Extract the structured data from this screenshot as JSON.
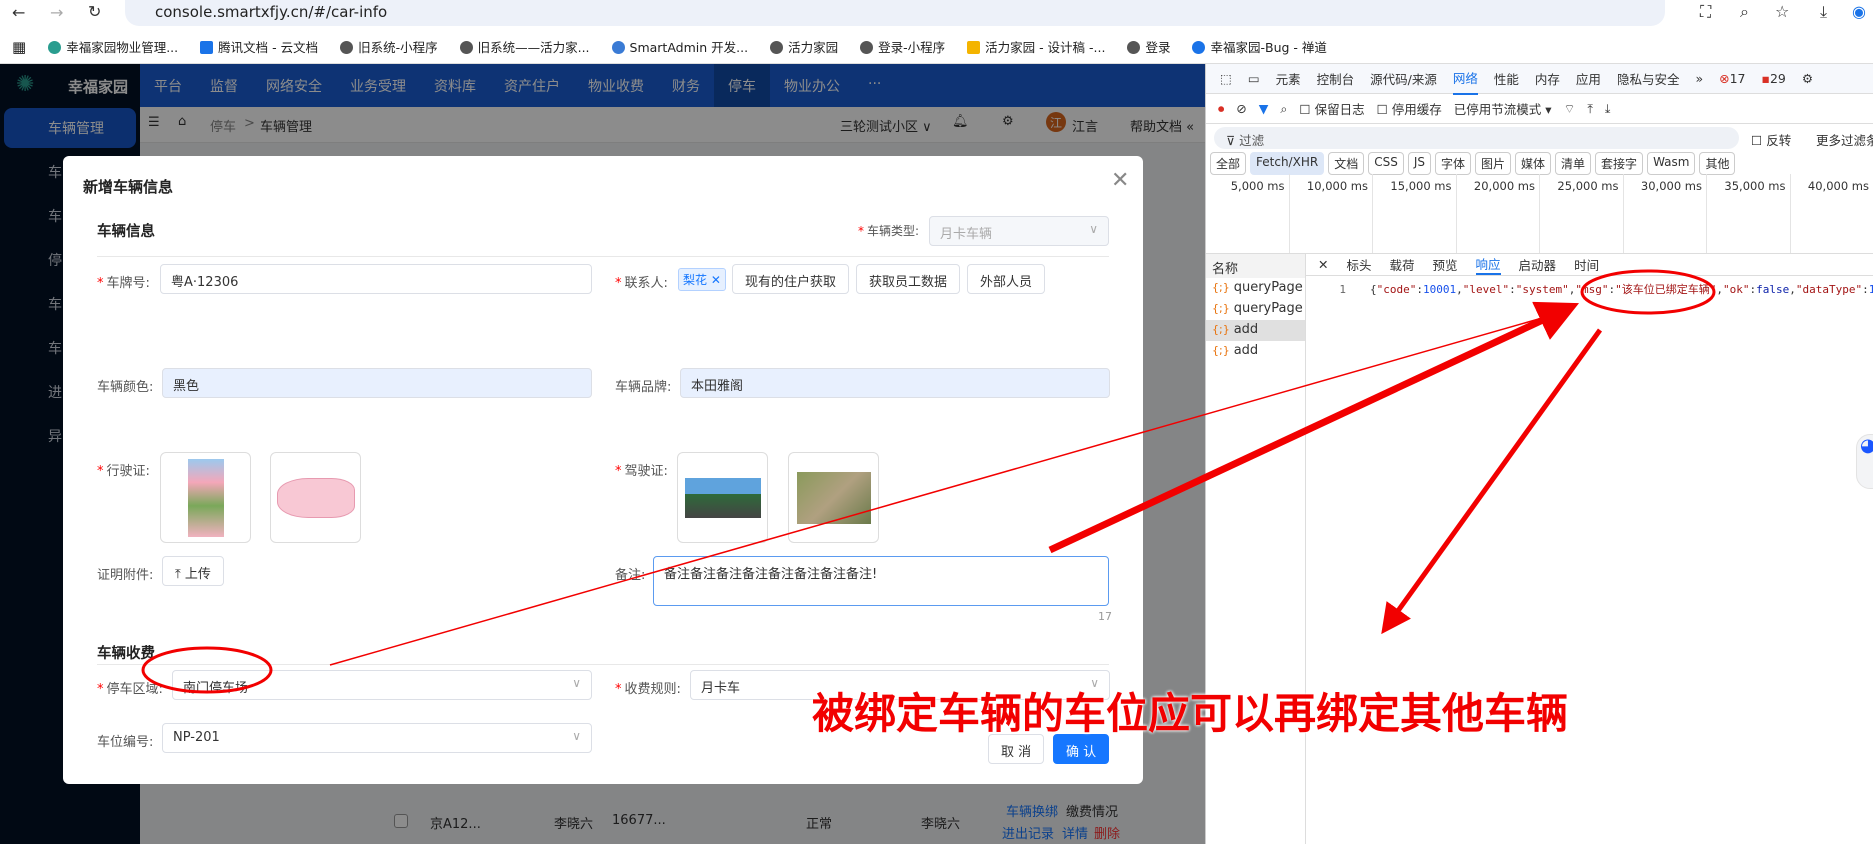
{
  "browser": {
    "url": "console.smartxfjy.cn/#/car-info",
    "bookmarks": [
      "幸福家园物业管理...",
      "腾讯文档 - 云文档",
      "旧系统-小程序",
      "旧系统——活力家...",
      "SmartAdmin 开发...",
      "活力家园",
      "登录-小程序",
      "活力家园 - 设计稿 -...",
      "登录",
      "幸福家园-Bug - 禅道"
    ]
  },
  "app": {
    "logo": "幸福家园",
    "top_nav": [
      "平台",
      "监督",
      "网络安全",
      "业务受理",
      "资料库",
      "资产住户",
      "物业收费",
      "财务",
      "停车",
      "物业办公",
      "···"
    ],
    "sidebar": [
      "车辆管理",
      "车",
      "车",
      "停",
      "车",
      "车",
      "进",
      "异"
    ],
    "breadcrumb": {
      "parent": "停车",
      "sep": ">",
      "current": "车辆管理"
    },
    "community": "三轮测试小区 ∨",
    "user_initial": "江",
    "user": "江言",
    "help": "帮助文档 «",
    "bg_row": {
      "plate": "京A12...",
      "owner": "李晓六",
      "phone": "16677...",
      "status": "正常",
      "contact": "李晓六",
      "links": [
        "车辆换绑",
        "缴费情况",
        "进出记录",
        "详情",
        "删除"
      ]
    }
  },
  "dialog": {
    "title": "新增车辆信息",
    "section1": "车辆信息",
    "vehicle_type_label": "车辆类型:",
    "vehicle_type": "月卡车辆",
    "plate_label": "车牌号:",
    "plate": "粤A·12306",
    "contact_label": "联系人:",
    "contact_tag": "梨花",
    "contact_buttons": [
      "现有的住户获取",
      "获取员工数据",
      "外部人员"
    ],
    "color_label": "车辆颜色:",
    "color": "黑色",
    "brand_label": "车辆品牌:",
    "brand": "本田雅阁",
    "license_label": "行驶证:",
    "driver_label": "驾驶证:",
    "attach_label": "证明附件:",
    "upload": "上传",
    "remark_label": "备注:",
    "remark": "备注备注备注备注备注备注备注备注!",
    "remark_count": "17",
    "section2": "车辆收费",
    "area_label": "停车区域:",
    "area": "南门停车场",
    "rule_label": "收费规则:",
    "rule": "月卡车",
    "spot_label": "车位编号:",
    "spot": "NP-201",
    "cancel": "取 消",
    "confirm": "确 认"
  },
  "devtools": {
    "tabs": [
      "元素",
      "控制台",
      "源代码/来源",
      "网络",
      "性能",
      "内存",
      "应用",
      "隐私与安全",
      "»"
    ],
    "errors": "17",
    "warnings": "29",
    "toolbar": {
      "preserve_log": "保留日志",
      "disable_cache": "停用缓存",
      "throttle": "已停用节流模式"
    },
    "filter_placeholder": "过滤",
    "invert": "反转",
    "more_filters": "更多过滤条件",
    "types": [
      "全部",
      "Fetch/XHR",
      "文档",
      "CSS",
      "JS",
      "字体",
      "图片",
      "媒体",
      "清单",
      "套接字",
      "Wasm",
      "其他"
    ],
    "timeline": [
      "5,000 ms",
      "10,000 ms",
      "15,000 ms",
      "20,000 ms",
      "25,000 ms",
      "30,000 ms",
      "35,000 ms",
      "40,000 ms"
    ],
    "name_header": "名称",
    "requests": [
      "queryPage",
      "queryPage",
      "add",
      "add"
    ],
    "detail_tabs": [
      "标头",
      "载荷",
      "预览",
      "响应",
      "启动器",
      "时间"
    ],
    "response": {
      "line": "1",
      "code": "10001",
      "level": "system",
      "msg": "该车位已绑定车辆",
      "ok": "false",
      "dataType": "1"
    }
  },
  "annotation": "被绑定车辆的车位应可以再绑定其他车辆",
  "colors": {
    "accent": "#1677ff",
    "annotation": "#f20000",
    "nav": "#1a5dd3"
  }
}
